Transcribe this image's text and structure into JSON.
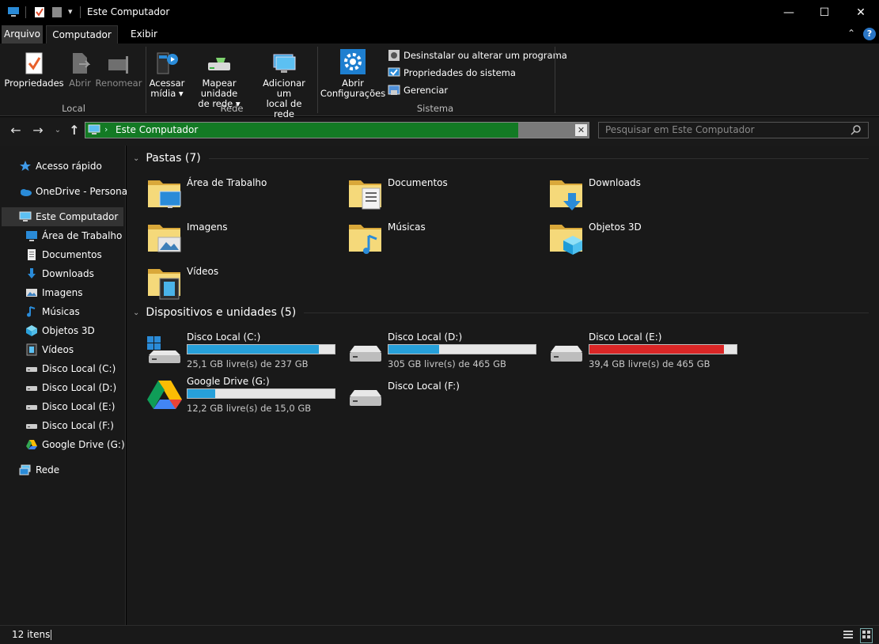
{
  "window": {
    "title": "Este Computador",
    "controls": [
      "—",
      "☐",
      "✕"
    ]
  },
  "ribbon_tabs": [
    {
      "label": "Arquivo"
    },
    {
      "label": "Computador"
    },
    {
      "label": "Exibir"
    }
  ],
  "ribbon": {
    "local": {
      "group_label": "Local",
      "propriedades": "Propriedades",
      "abrir": "Abrir",
      "renomear": "Renomear"
    },
    "rede": {
      "group_label": "Rede",
      "acessar_1": "Acessar",
      "acessar_2": "mídia",
      "mapear_1": "Mapear unidade",
      "mapear_2": "de rede",
      "adicionar_1": "Adicionar um",
      "adicionar_2": "local de rede"
    },
    "sistema": {
      "group_label": "Sistema",
      "abrir_1": "Abrir",
      "abrir_2": "Configurações",
      "desinstalar": "Desinstalar ou alterar um programa",
      "propriedades_sistema": "Propriedades do sistema",
      "gerenciar": "Gerenciar"
    }
  },
  "address": {
    "path": "Este Computador",
    "search_placeholder": "Pesquisar em Este Computador",
    "fill_percent": 86
  },
  "nav_pane": {
    "quick_access": "Acesso rápido",
    "onedrive": "OneDrive - Personal",
    "this_pc": "Este Computador",
    "children": [
      {
        "label": "Área de Trabalho",
        "icon": "desktop-icon"
      },
      {
        "label": "Documentos",
        "icon": "documents-icon"
      },
      {
        "label": "Downloads",
        "icon": "downloads-icon"
      },
      {
        "label": "Imagens",
        "icon": "images-icon"
      },
      {
        "label": "Músicas",
        "icon": "music-icon"
      },
      {
        "label": "Objetos 3D",
        "icon": "3d-objects-icon"
      },
      {
        "label": "Vídeos",
        "icon": "videos-icon"
      },
      {
        "label": "Disco Local (C:)",
        "icon": "drive-icon"
      },
      {
        "label": "Disco Local (D:)",
        "icon": "drive-icon"
      },
      {
        "label": "Disco Local (E:)",
        "icon": "drive-icon"
      },
      {
        "label": "Disco Local (F:)",
        "icon": "drive-icon"
      },
      {
        "label": "Google Drive (G:)",
        "icon": "google-drive-icon"
      }
    ],
    "rede": "Rede"
  },
  "folders": {
    "header": "Pastas (7)",
    "items": [
      {
        "label": "Área de Trabalho"
      },
      {
        "label": "Documentos"
      },
      {
        "label": "Downloads"
      },
      {
        "label": "Imagens"
      },
      {
        "label": "Músicas"
      },
      {
        "label": "Objetos 3D"
      },
      {
        "label": "Vídeos"
      }
    ]
  },
  "devices": {
    "header": "Dispositivos e unidades (5)",
    "items": [
      {
        "label": "Disco Local (C:)",
        "free_text": "25,1 GB livre(s) de 237 GB",
        "used_fraction": 0.894,
        "bar_color": "#26a0da"
      },
      {
        "label": "Disco Local (D:)",
        "free_text": "305 GB livre(s) de 465 GB",
        "used_fraction": 0.344,
        "bar_color": "#26a0da"
      },
      {
        "label": "Disco Local (E:)",
        "free_text": "39,4 GB livre(s) de 465 GB",
        "used_fraction": 0.915,
        "bar_color": "#da2626"
      },
      {
        "label": "Google Drive (G:)",
        "free_text": "12,2 GB livre(s) de 15,0 GB",
        "used_fraction": 0.187,
        "bar_color": "#26a0da"
      },
      {
        "label": "Disco Local (F:)",
        "free_text": "",
        "used_fraction": null,
        "bar_color": ""
      }
    ]
  },
  "status": {
    "count": "12 itens"
  },
  "colors": {
    "address_fill": "#137a24",
    "accent_blue": "#26a0da",
    "danger_red": "#da2626"
  }
}
